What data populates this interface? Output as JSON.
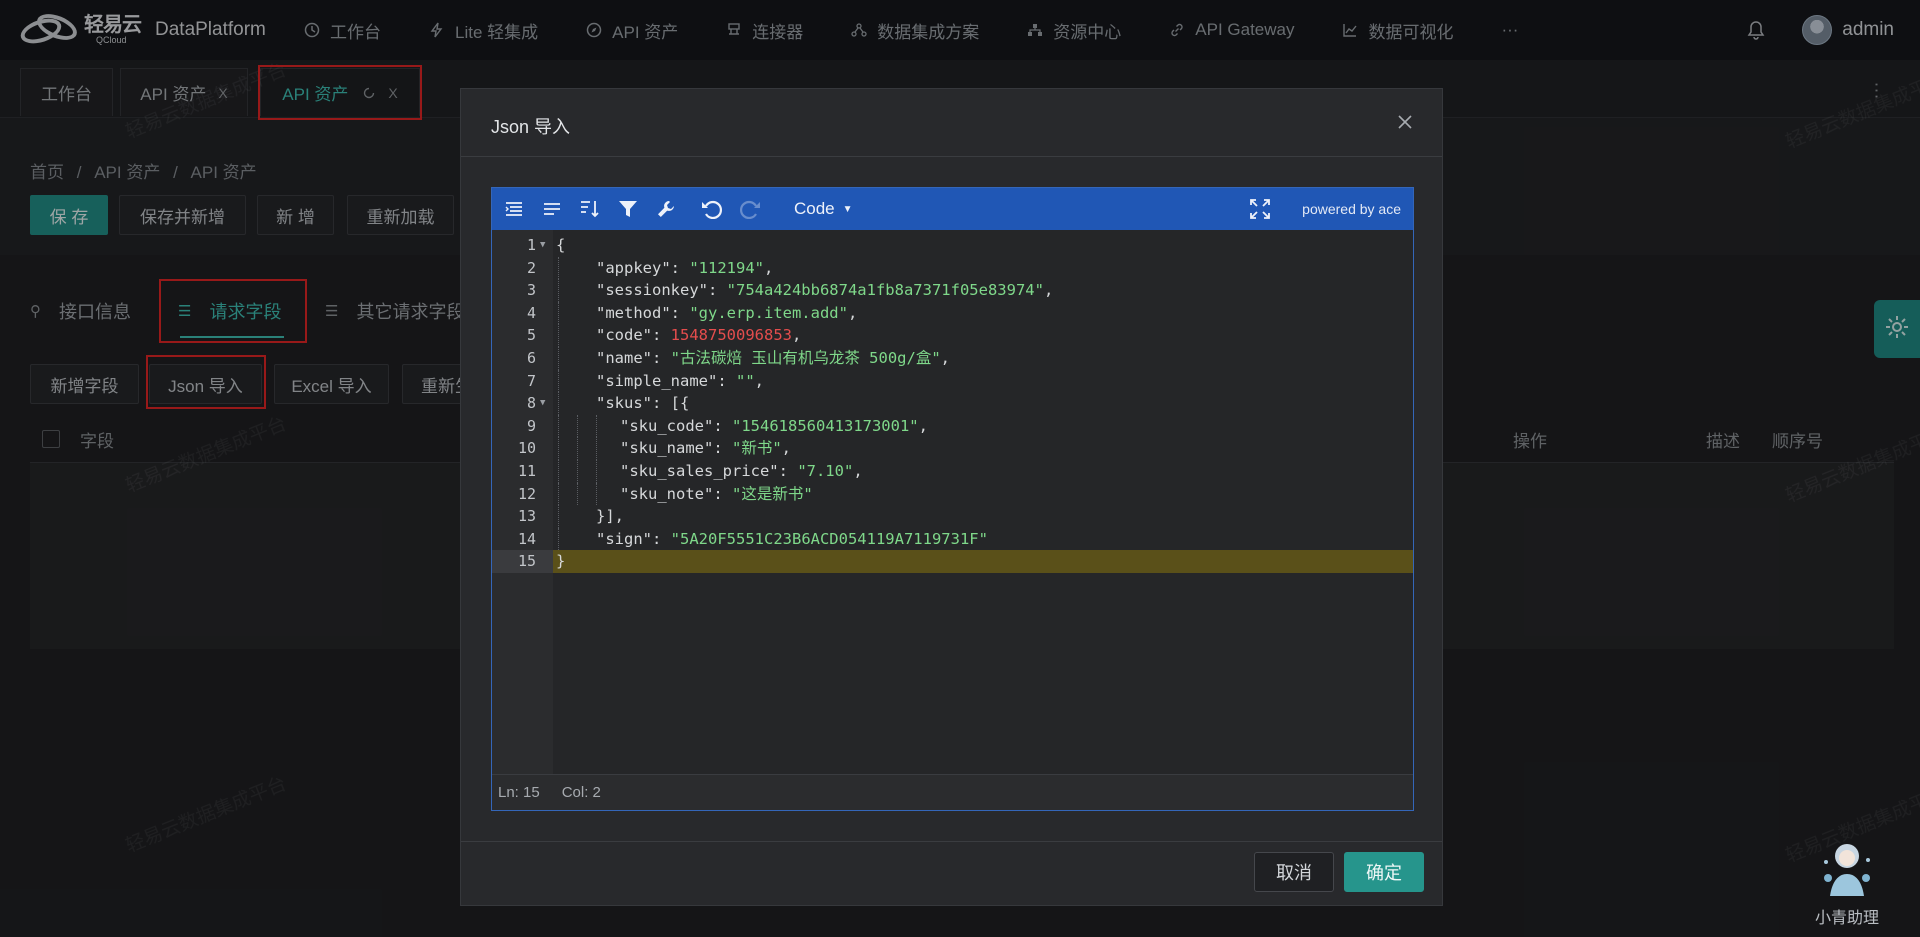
{
  "app": {
    "logo_cn": "轻易云",
    "logo_en": "QCloud",
    "product": "DataPlatform",
    "accent": "#3fbfb3",
    "primary_button": "#238e86"
  },
  "topnav": {
    "items": [
      {
        "label": "工作台",
        "icon": "clock-icon"
      },
      {
        "label": "Lite 轻集成",
        "icon": "lightning-icon"
      },
      {
        "label": "API 资产",
        "icon": "compass-icon"
      },
      {
        "label": "连接器",
        "icon": "connector-icon"
      },
      {
        "label": "数据集成方案",
        "icon": "network-icon"
      },
      {
        "label": "资源中心",
        "icon": "sitemap-icon"
      },
      {
        "label": "API Gateway",
        "icon": "link-icon"
      },
      {
        "label": "数据可视化",
        "icon": "chart-icon"
      },
      {
        "label": "···",
        "icon": ""
      }
    ],
    "username": "admin"
  },
  "page_tabs": [
    {
      "label": "工作台"
    },
    {
      "label": "API 资产",
      "close": "X"
    },
    {
      "label": "API 资产",
      "close": "X",
      "active": true
    }
  ],
  "breadcrumb": [
    "首页",
    "/",
    "API 资产",
    "/",
    "API 资产"
  ],
  "toolbar": {
    "save": "保 存",
    "save_new": "保存并新增",
    "add": "新 增",
    "reload": "重新加载"
  },
  "subtabs": [
    {
      "label": "接口信息"
    },
    {
      "label": "请求字段",
      "active": true
    },
    {
      "label": "其它请求字段"
    }
  ],
  "field_actions": {
    "add_field": "新增字段",
    "json_import": "Json 导入",
    "excel_import": "Excel 导入",
    "regenerate": "重新生成"
  },
  "table": {
    "columns": {
      "field": "字段",
      "action": "操作",
      "desc": "描述",
      "order": "顺序号"
    }
  },
  "watermark": "轻易云数据集成平台",
  "modal": {
    "title": "Json 导入",
    "cancel": "取消",
    "confirm": "确定",
    "editor": {
      "mode": "Code",
      "powered_by": "powered by ace",
      "status_ln": "Ln: 15",
      "status_col": "Col: 2",
      "lines": [
        {
          "n": "1",
          "indent": 0,
          "fold": true,
          "tokens": [
            {
              "t": "p",
              "v": "{"
            }
          ]
        },
        {
          "n": "2",
          "indent": 1,
          "tokens": [
            {
              "t": "k",
              "v": "\"appkey\""
            },
            {
              "t": "p",
              "v": ": "
            },
            {
              "t": "s",
              "v": "\"112194\""
            },
            {
              "t": "p",
              "v": ","
            }
          ]
        },
        {
          "n": "3",
          "indent": 1,
          "tokens": [
            {
              "t": "k",
              "v": "\"sessionkey\""
            },
            {
              "t": "p",
              "v": ": "
            },
            {
              "t": "s",
              "v": "\"754a424bb6874a1fb8a7371f05e83974\""
            },
            {
              "t": "p",
              "v": ","
            }
          ]
        },
        {
          "n": "4",
          "indent": 1,
          "tokens": [
            {
              "t": "k",
              "v": "\"method\""
            },
            {
              "t": "p",
              "v": ": "
            },
            {
              "t": "s",
              "v": "\"gy.erp.item.add\""
            },
            {
              "t": "p",
              "v": ","
            }
          ]
        },
        {
          "n": "5",
          "indent": 1,
          "tokens": [
            {
              "t": "k",
              "v": "\"code\""
            },
            {
              "t": "p",
              "v": ": "
            },
            {
              "t": "n",
              "v": "1548750096853"
            },
            {
              "t": "p",
              "v": ","
            }
          ]
        },
        {
          "n": "6",
          "indent": 1,
          "tokens": [
            {
              "t": "k",
              "v": "\"name\""
            },
            {
              "t": "p",
              "v": ": "
            },
            {
              "t": "s",
              "v": "\"古法碳焙 玉山有机乌龙茶 500g/盒\""
            },
            {
              "t": "p",
              "v": ","
            }
          ]
        },
        {
          "n": "7",
          "indent": 1,
          "tokens": [
            {
              "t": "k",
              "v": "\"simple_name\""
            },
            {
              "t": "p",
              "v": ": "
            },
            {
              "t": "s",
              "v": "\"\""
            },
            {
              "t": "p",
              "v": ","
            }
          ]
        },
        {
          "n": "8",
          "indent": 1,
          "fold": true,
          "tokens": [
            {
              "t": "k",
              "v": "\"skus\""
            },
            {
              "t": "p",
              "v": ": [{"
            }
          ]
        },
        {
          "n": "9",
          "indent": 3,
          "tokens": [
            {
              "t": "k",
              "v": "\"sku_code\""
            },
            {
              "t": "p",
              "v": ": "
            },
            {
              "t": "s",
              "v": "\"154618560413173001\""
            },
            {
              "t": "p",
              "v": ","
            }
          ]
        },
        {
          "n": "10",
          "indent": 3,
          "tokens": [
            {
              "t": "k",
              "v": "\"sku_name\""
            },
            {
              "t": "p",
              "v": ": "
            },
            {
              "t": "s",
              "v": "\"新书\""
            },
            {
              "t": "p",
              "v": ","
            }
          ]
        },
        {
          "n": "11",
          "indent": 3,
          "tokens": [
            {
              "t": "k",
              "v": "\"sku_sales_price\""
            },
            {
              "t": "p",
              "v": ": "
            },
            {
              "t": "s",
              "v": "\"7.10\""
            },
            {
              "t": "p",
              "v": ","
            }
          ]
        },
        {
          "n": "12",
          "indent": 3,
          "tokens": [
            {
              "t": "k",
              "v": "\"sku_note\""
            },
            {
              "t": "p",
              "v": ": "
            },
            {
              "t": "s",
              "v": "\"这是新书\""
            }
          ]
        },
        {
          "n": "13",
          "indent": 1,
          "tokens": [
            {
              "t": "p",
              "v": "}],"
            }
          ]
        },
        {
          "n": "14",
          "indent": 1,
          "tokens": [
            {
              "t": "k",
              "v": "\"sign\""
            },
            {
              "t": "p",
              "v": ": "
            },
            {
              "t": "s",
              "v": "\"5A20F5551C23B6ACD054119A7119731F\""
            }
          ]
        },
        {
          "n": "15",
          "indent": 0,
          "active": true,
          "tokens": [
            {
              "t": "p",
              "v": "}"
            }
          ]
        }
      ]
    }
  },
  "assistant": {
    "label": "小青助理"
  }
}
